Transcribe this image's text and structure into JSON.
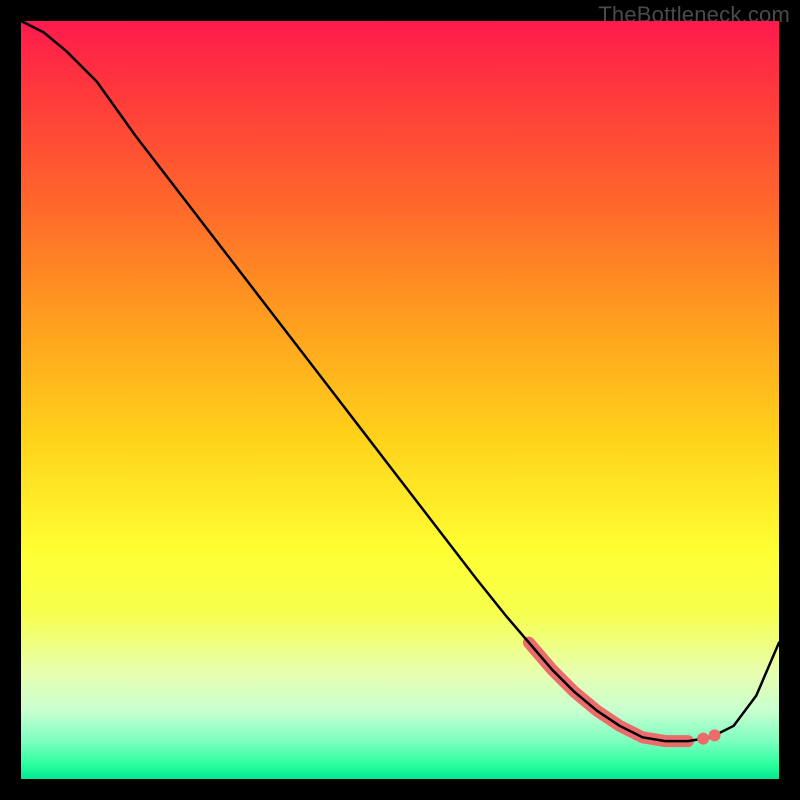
{
  "watermark": "TheBottleneck.com",
  "colors": {
    "page_bg": "#000000",
    "gradient_top": "#ff1a4d",
    "gradient_bottom": "#00e890",
    "curve": "#000000",
    "highlight": "#ec6b6b"
  },
  "chart_data": {
    "type": "line",
    "title": "",
    "xlabel": "",
    "ylabel": "",
    "xlim": [
      0,
      100
    ],
    "ylim": [
      0,
      100
    ],
    "series": [
      {
        "name": "bottleneck-curve",
        "x": [
          0,
          3,
          6,
          10,
          15,
          20,
          25,
          30,
          35,
          40,
          45,
          50,
          55,
          60,
          64,
          67,
          70,
          73,
          76,
          79,
          82,
          85,
          88,
          91,
          94,
          97,
          100
        ],
        "y": [
          100,
          98.5,
          96,
          92,
          85,
          78.5,
          72,
          65.5,
          59,
          52.5,
          46,
          39.5,
          33,
          26.5,
          21.5,
          18,
          14.5,
          11.5,
          9,
          7,
          5.5,
          5,
          5,
          5.5,
          7,
          11,
          18
        ]
      }
    ],
    "highlight_range_x": [
      67,
      88
    ],
    "highlight_dots_x": [
      90,
      91.5
    ]
  }
}
